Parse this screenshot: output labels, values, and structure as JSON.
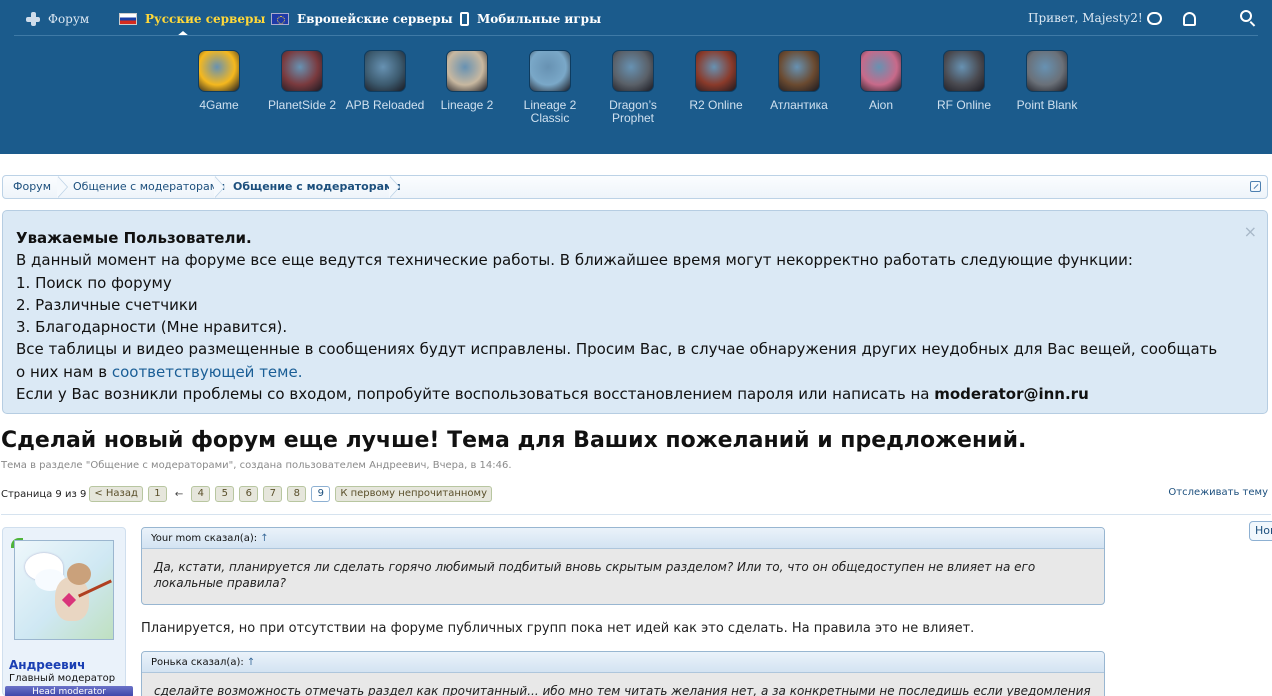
{
  "topnav": {
    "forum": "Форум",
    "ru_servers": "Русские серверы",
    "eu_servers": "Европейские серверы",
    "mobile": "Мобильные игры",
    "greeting": "Привет, Majesty2!"
  },
  "games": [
    {
      "label": "4Game",
      "icon": "4game-icon",
      "color": "#f5b81e"
    },
    {
      "label": "PlanetSide 2",
      "icon": "planetside-icon",
      "color": "#7a3a3e"
    },
    {
      "label": "APB Reloaded",
      "icon": "apb-icon",
      "color": "#3c5a6e"
    },
    {
      "label": "Lineage 2",
      "icon": "lineage2-icon",
      "color": "#c8b8a0"
    },
    {
      "label": "Lineage 2 Classic",
      "icon": "lineage2-classic-icon",
      "color": "#7aa8c8"
    },
    {
      "label": "Dragon's Prophet",
      "icon": "dragons-prophet-icon",
      "color": "#5a6068"
    },
    {
      "label": "R2 Online",
      "icon": "r2-icon",
      "color": "#8a3a2a"
    },
    {
      "label": "Атлантика",
      "icon": "atlantica-icon",
      "color": "#6a4a30"
    },
    {
      "label": "Aion",
      "icon": "aion-icon",
      "color": "#c86a8a"
    },
    {
      "label": "RF Online",
      "icon": "rf-online-icon",
      "color": "#4a4a50"
    },
    {
      "label": "Point Blank",
      "icon": "point-blank-icon",
      "color": "#6a7078"
    }
  ],
  "breadcrumb": {
    "items": [
      "Форум",
      "Общение с модераторами",
      "Общение с модераторами"
    ]
  },
  "notice": {
    "heading": "Уважаемые Пользователи.",
    "line1": "В данный момент на форуме все еще ведутся технические работы. В ближайшее время могут некорректно работать следующие функции:",
    "item1": "1. Поиск по форуму",
    "item2": "2. Различные счетчики",
    "item3": "3. Благодарности (Мне нравится).",
    "line2": "Все таблицы и видео размещенные в сообщениях будут исправлены. Просим Вас, в случае обнаружения других неудобных для Вас вещей, сообщать",
    "line3_prefix": "о них нам в ",
    "line3_link": "соответствующей теме.",
    "line4_prefix": "Если у Вас возникли проблемы со входом, попробуйте воспользоваться восстановлением пароля или написать на ",
    "line4_email": "moderator@inn.ru",
    "close": "×"
  },
  "thread": {
    "title": "Сделай новый форум еще лучше! Тема для Ваших пожеланий и предложений.",
    "meta": "Тема в разделе \"Общение с модераторами\", создана пользователем Андреевич, Вчера, в 14:46."
  },
  "pagination": {
    "label": "Страница 9 из 9",
    "prev": "< Назад",
    "first": "1",
    "arrow": "←",
    "pages": [
      "4",
      "5",
      "6",
      "7",
      "8",
      "9"
    ],
    "current": "9",
    "first_unread": "К первому непрочитанному",
    "watch": "Отслеживать тему"
  },
  "post": {
    "author": "Андреевич",
    "author_title": "Главный модератор",
    "rank": "Head moderator",
    "quote1_head": "Your mom сказал(а):",
    "quote1_line1": "Да, кстати, планируется ли сделать горячо любимый подбитый вновь скрытым разделом? Или то, что он общедоступен не влияет на его",
    "quote1_line2": "локальные правила?",
    "reply": "Планируется, но при отсутствии на форуме публичных групп пока нет идей как это сделать. На правила это не влияет.",
    "quote2_head": "Ронька сказал(а):",
    "quote2_line1": "сделайте возможность отмечать раздел как прочитанный... ибо мно тем читать желания нет, а за конкретными не последишь если уведомления",
    "up_arrow": "↑"
  },
  "side": {
    "new_btn": "Новые"
  },
  "colors": {
    "header_bg": "#1b5b8c",
    "active_nav": "#ffd83a",
    "link": "#1c4f7d",
    "notice_bg": "#dbe9f5"
  }
}
